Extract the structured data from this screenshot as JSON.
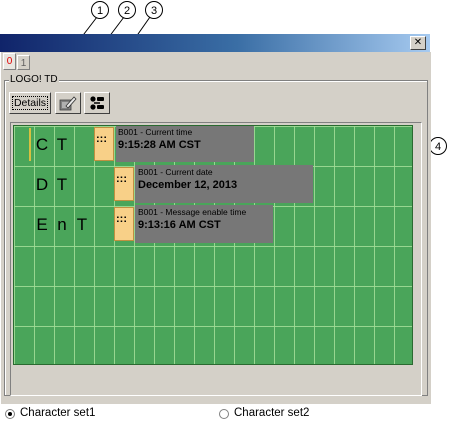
{
  "callouts": [
    "1",
    "2",
    "3",
    "4"
  ],
  "window": {
    "close_symbol": "✕",
    "tabs": [
      {
        "label": "0",
        "active": true
      },
      {
        "label": "1",
        "active": false
      }
    ],
    "group_title": "LOGO! TD"
  },
  "toolbar": {
    "details_label": "Details",
    "edit_icon": "edit-icon",
    "connection_icon": "connection-icon"
  },
  "display": {
    "rows": [
      {
        "chars": [
          "C",
          "T"
        ]
      },
      {
        "chars": [
          "D",
          "T"
        ]
      },
      {
        "chars": [
          "E",
          "n",
          "T"
        ]
      }
    ],
    "blocks": [
      {
        "tab_dots": ":::",
        "label": "B001 - Current time",
        "value": "9:15:28 AM CST"
      },
      {
        "tab_dots": ":::",
        "label": "B001 - Current date",
        "value": "December 12, 2013"
      },
      {
        "tab_dots": ":::",
        "label": "B001 - Message enable time",
        "value": "9:13:16 AM CST"
      }
    ]
  },
  "character_sets": [
    {
      "label": "Character set1",
      "selected": true
    },
    {
      "label": "Character set2",
      "selected": false
    }
  ],
  "colors": {
    "display_green": "#4aa55a",
    "block_gray": "#777777",
    "block_tab": "#f8d088",
    "title_bar": "#10246a"
  }
}
